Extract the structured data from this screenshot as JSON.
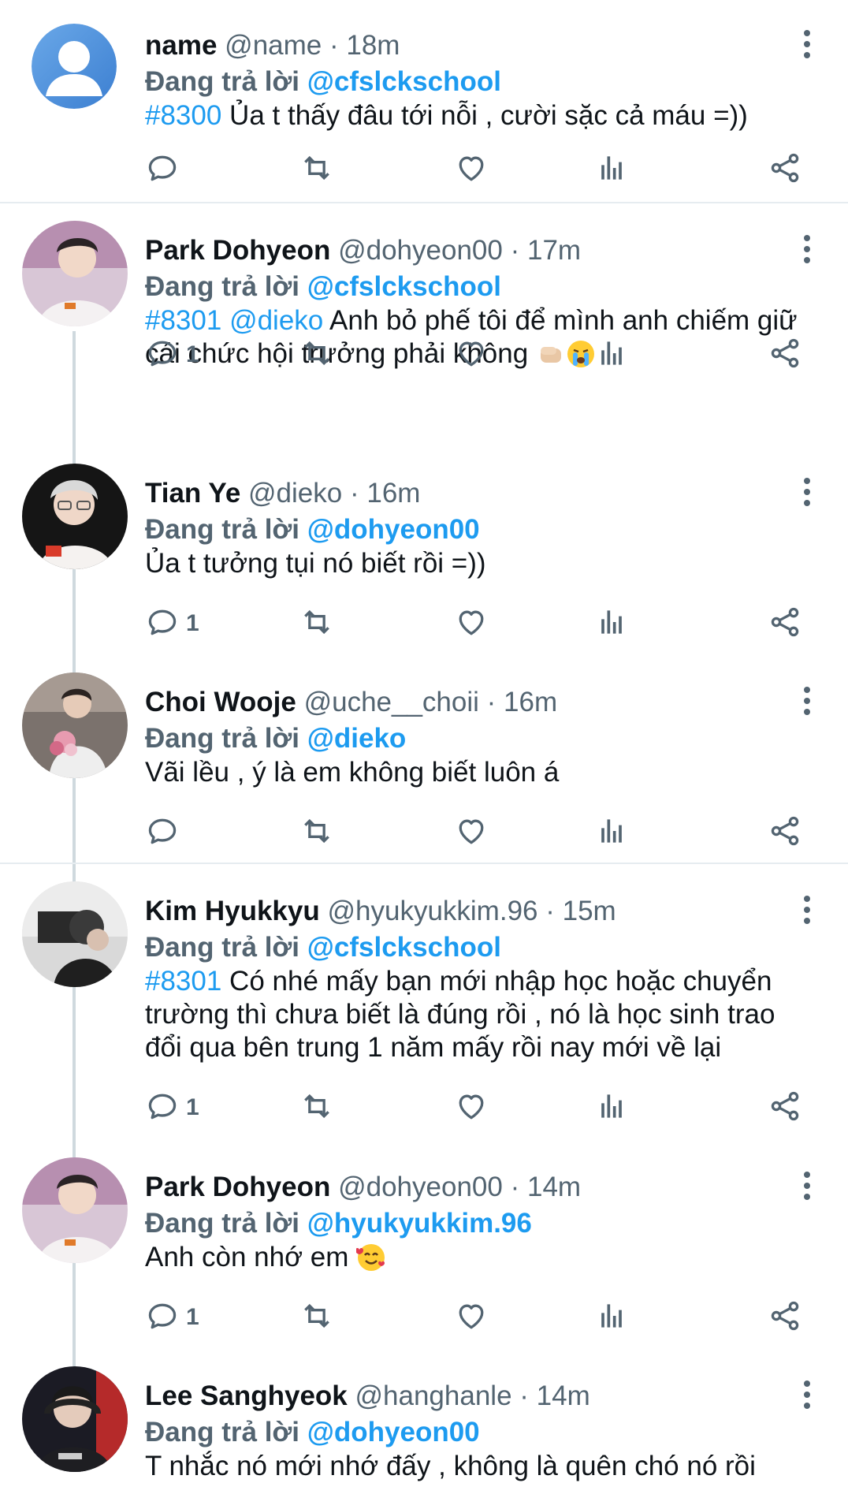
{
  "reply_prefix": "Đang trả lời",
  "tweets": [
    {
      "name": "name",
      "handle": "@name",
      "time": "· 18m",
      "reply_to": "@cfslckschool",
      "hashtag": "#8300",
      "mention": "",
      "text": " Ủa t thấy đâu tới nỗi , cười sặc cả máu =))",
      "reply_count": ""
    },
    {
      "name": "Park Dohyeon",
      "handle": "@dohyeon00",
      "time": "· 17m",
      "reply_to": "@cfslckschool",
      "hashtag": "#8301",
      "mention": "@dieko",
      "text": " Anh bỏ phế tôi để mình anh chiếm giữ cái chức hội trưởng phải không",
      "reply_count": "1"
    },
    {
      "name": "Tian Ye",
      "handle": "@dieko",
      "time": "· 16m",
      "reply_to": "@dohyeon00",
      "hashtag": "",
      "mention": "",
      "text": "Ủa t tưởng tụi nó biết rồi =))",
      "reply_count": "1"
    },
    {
      "name": "Choi Wooje",
      "handle": "@uche__choii",
      "time": "· 16m",
      "reply_to": "@dieko",
      "hashtag": "",
      "mention": "",
      "text": "Vãi lều , ý là em không biết luôn á",
      "reply_count": ""
    },
    {
      "name": "Kim Hyukkyu",
      "handle": "@hyukyukkim.96",
      "time": "· 15m",
      "reply_to": "@cfslckschool",
      "hashtag": "#8301",
      "mention": "",
      "text": " Có nhé mấy bạn mới nhập học hoặc chuyển trường thì chưa biết là đúng rồi , nó là học sinh trao đổi qua bên trung 1 năm mấy rồi nay mới về lại",
      "reply_count": "1"
    },
    {
      "name": "Park Dohyeon",
      "handle": "@dohyeon00",
      "time": "· 14m",
      "reply_to": "@hyukyukkim.96",
      "hashtag": "",
      "mention": "",
      "text": "Anh còn nhớ em",
      "reply_count": "1"
    },
    {
      "name": "Lee Sanghyeok",
      "handle": "@hanghanle",
      "time": "· 14m",
      "reply_to": "@dohyeon00",
      "hashtag": "",
      "mention": "",
      "text": "T nhắc nó mới nhớ đấy , không là quên chó nó rồi",
      "reply_count": ""
    }
  ],
  "icons": {
    "reply": "reply-icon",
    "retweet": "retweet-icon",
    "like": "heart-icon",
    "views": "analytics-icon",
    "share": "share-icon",
    "menu": "more-vertical-icon"
  },
  "colors": {
    "link": "#1d9bf0",
    "secondary": "#536471",
    "thread_line": "#cfd9de"
  }
}
